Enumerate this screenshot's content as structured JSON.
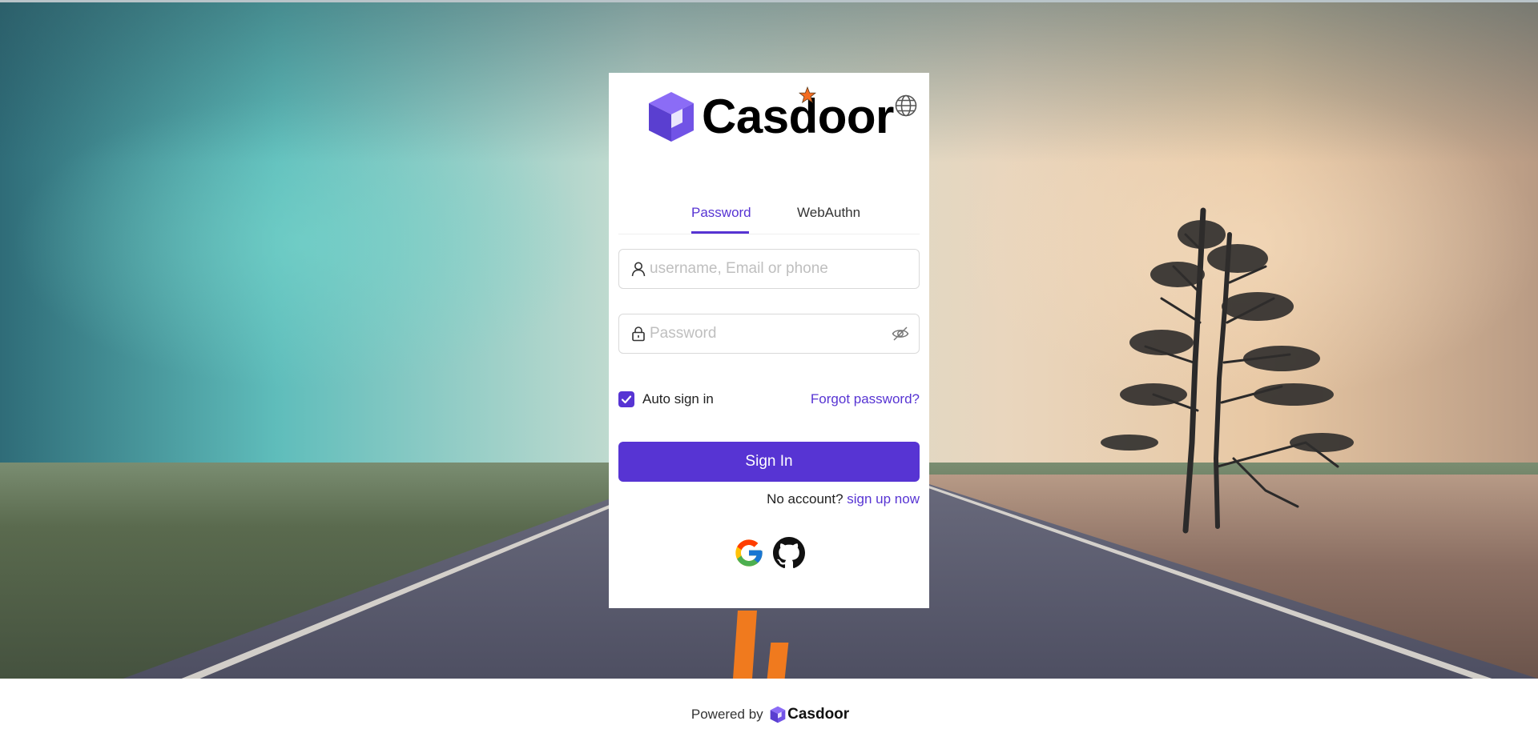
{
  "app": {
    "brand_name": "Casdoor",
    "accent_color": "#5734d3"
  },
  "header": {
    "language_icon": "globe-icon"
  },
  "tabs": [
    {
      "label": "Password",
      "active": true
    },
    {
      "label": "WebAuthn",
      "active": false
    }
  ],
  "username_field": {
    "placeholder": "username, Email or phone",
    "value": "",
    "icon": "user-icon"
  },
  "password_field": {
    "placeholder": "Password",
    "value": "",
    "icon": "lock-icon",
    "toggle_icon": "eye-invisible-icon"
  },
  "auto_sign_in": {
    "label": "Auto sign in",
    "checked": true
  },
  "forgot_password": {
    "label": "Forgot password?"
  },
  "sign_in_button": {
    "label": "Sign In"
  },
  "signup": {
    "prompt": "No account?",
    "link_label": "sign up now"
  },
  "providers": [
    {
      "name": "Google",
      "icon": "google-icon"
    },
    {
      "name": "GitHub",
      "icon": "github-icon"
    }
  ],
  "footer": {
    "powered_by": "Powered by",
    "brand_name": "Casdoor"
  }
}
